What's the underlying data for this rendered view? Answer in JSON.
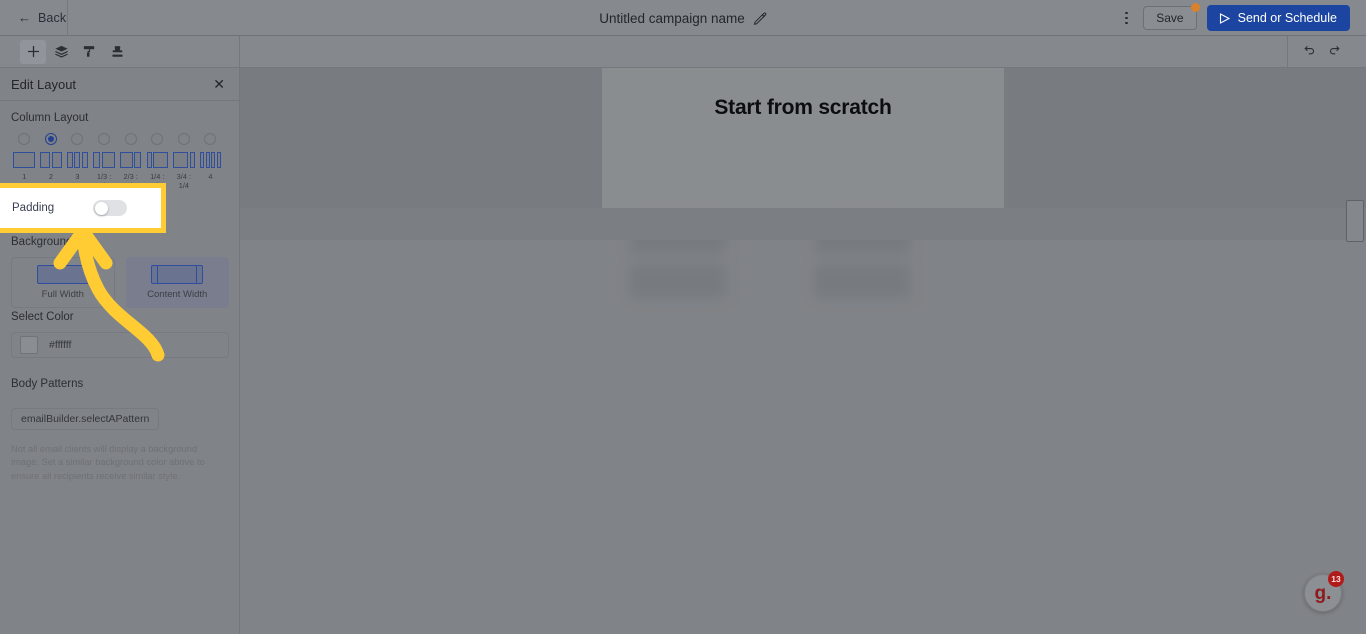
{
  "topbar": {
    "back_label": "Back",
    "back_icon": "arrow-left-icon",
    "campaign_title": "Untitled campaign name",
    "edit_icon": "pencil-icon",
    "overflow_icon": "kebab-menu-icon",
    "save_label": "Save",
    "send_label": "Send or Schedule",
    "send_icon": "send-triangle-icon",
    "accent_blue": "#1b45a0",
    "unsaved_dot_color": "#d9822b"
  },
  "toolbar": {
    "items": [
      {
        "name": "add-block-icon",
        "label": "Add"
      },
      {
        "name": "layers-icon",
        "label": "Layers"
      },
      {
        "name": "paint-roller-icon",
        "label": "Styles"
      },
      {
        "name": "body-stamp-icon",
        "label": "Body"
      }
    ],
    "undo_icon": "undo-icon",
    "redo_icon": "redo-icon"
  },
  "panel": {
    "title": "Edit Layout",
    "close_icon": "close-icon",
    "column_layout": {
      "label": "Column Layout",
      "selected_index": 1,
      "options": [
        {
          "label": "1",
          "cols": [
            1
          ]
        },
        {
          "label": "2",
          "cols": [
            1,
            1
          ]
        },
        {
          "label": "3",
          "cols": [
            1,
            1,
            1
          ]
        },
        {
          "label": "1/3 : 2/3",
          "cols": [
            1,
            2
          ]
        },
        {
          "label": "2/3 : 1/3",
          "cols": [
            2,
            1
          ]
        },
        {
          "label": "1/4 : 3/4",
          "cols": [
            1,
            3
          ]
        },
        {
          "label": "3/4 : 1/4",
          "cols": [
            3,
            1
          ]
        },
        {
          "label": "4",
          "cols": [
            1,
            1,
            1,
            1
          ]
        }
      ]
    },
    "padding": {
      "label": "Padding",
      "enabled": false,
      "highlight_color": "#ffcc33"
    },
    "background_type": {
      "label": "Background type",
      "options": [
        {
          "label": "Full Width",
          "icon": "full-width-icon",
          "selected": false
        },
        {
          "label": "Content Width",
          "icon": "content-width-icon",
          "selected": true
        }
      ]
    },
    "select_color": {
      "label": "Select Color",
      "value": "#ffffff",
      "swatch_color": "#ffffff"
    },
    "body_patterns": {
      "label": "Body Patterns",
      "button_label": "emailBuilder.selectAPattern",
      "note": "Not all email clients will display a background image. Set a similar background color above to ensure all recipients receive similar style."
    }
  },
  "canvas": {
    "scratch_title": "Start from scratch"
  },
  "help": {
    "logo_text": "g.",
    "badge_count": "13"
  }
}
